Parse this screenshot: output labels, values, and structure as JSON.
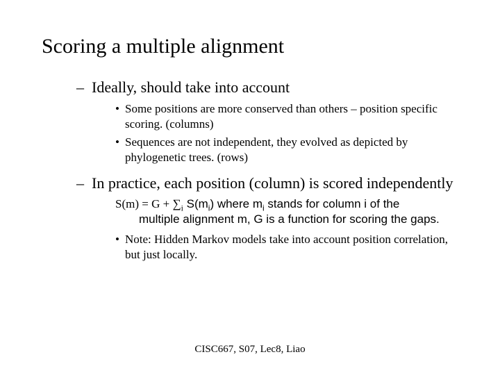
{
  "title": "Scoring a multiple alignment",
  "points": {
    "ideally": {
      "text": "Ideally, should take into account",
      "sub": {
        "conserved": "Some positions are more conserved than others – position specific scoring.  (columns)",
        "sequences": "Sequences are not independent, they evolved as depicted by phylogenetic trees. (rows)"
      }
    },
    "practice": {
      "text": "In practice, each position (column) is scored independently",
      "formula": {
        "lhs": "S(m) = G + ",
        "sigma": "∑",
        "sub_i": "i",
        "rhs1": " S(m",
        "sub_i2": "i",
        "rhs2": ")  where m",
        "sub_i3": "i",
        "rhs3": " stands for column i of the",
        "line2": "multiple alignment m, G is a function for scoring the gaps."
      },
      "note": "Note: Hidden Markov models take into account position correlation, but just locally."
    }
  },
  "footer": "CISC667, S07, Lec8, Liao"
}
